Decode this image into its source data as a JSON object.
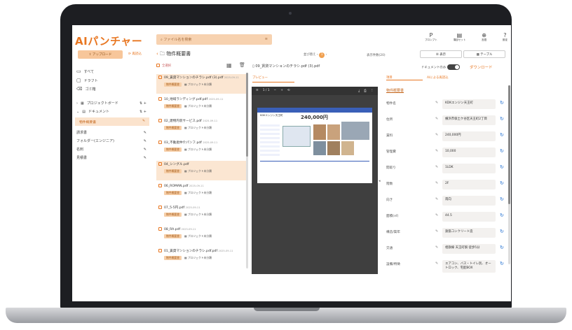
{
  "app": {
    "logo": "AIパンチャー"
  },
  "topbar": {
    "search_placeholder": "ファイル名を検索",
    "icons": [
      {
        "glyph": "P",
        "label": "プロンプト"
      },
      {
        "glyph": "▤",
        "label": "項目セット"
      },
      {
        "glyph": "⊕",
        "label": "言語"
      },
      {
        "glyph": "?",
        "label": "設定"
      }
    ]
  },
  "sidebar": {
    "upload_label": "アップロード",
    "reupload_label": "再読込",
    "items": [
      {
        "icon": "▭",
        "label": "すべて"
      },
      {
        "icon": "▢",
        "label": "ドラフト"
      },
      {
        "icon": "🗑",
        "label": "ゴミ箱"
      }
    ],
    "projects_label": "プロジェクトボード",
    "documents_label": "ドキュメント",
    "doc_items": [
      "物件概要書",
      "請求書",
      "フォルダー(エンジニア)",
      "名刺",
      "見積書"
    ]
  },
  "folder": {
    "title": "物件概要書",
    "select_all": "全選択",
    "sort_label": "並び替え",
    "pager": "1",
    "per_page": "表示件数(20)"
  },
  "files": [
    {
      "name": "09_賃貸マンションのチラシ.pdf (3).pdf",
      "date": "2025-09-11",
      "tag": "物件概要書",
      "proj": "プロジェクト未分類",
      "selected": true
    },
    {
      "name": "10_地域ランディング.pdf.pdf",
      "date": "2025-09-11",
      "tag": "物件概要書",
      "proj": "プロジェクト未分類",
      "selected": false
    },
    {
      "name": "02_建物内装サービス.pdf",
      "date": "2025-09-11",
      "tag": "物件概要書",
      "proj": "プロジェクト未分類",
      "selected": false
    },
    {
      "name": "03_不動産仲介パンフ.pdf",
      "date": "2025-09-11",
      "tag": "物件概要書",
      "proj": "プロジェクト未分類",
      "selected": false
    },
    {
      "name": "04_シングル.pdf",
      "date": "",
      "tag": "物件概要書",
      "proj": "プロジェクト未分類",
      "selected": true
    },
    {
      "name": "06_ROMAN.pdf",
      "date": "2025-09-11",
      "tag": "物件概要書",
      "proj": "プロジェクト未分類",
      "selected": false
    },
    {
      "name": "07_5-5円.pdf",
      "date": "2025-09-11",
      "tag": "物件概要書",
      "proj": "プロジェクト未分類",
      "selected": false
    },
    {
      "name": "08_RA.pdf",
      "date": "2025-09-11",
      "tag": "物件概要書",
      "proj": "プロジェクト未分類",
      "selected": false
    },
    {
      "name": "01_賃貸マンションのチラシ.pdf.pdf",
      "date": "2025-09-11",
      "tag": "物件概要書",
      "proj": "プロジェクト未分類",
      "selected": false
    }
  ],
  "viewer": {
    "file_title": "09_賃貸マンションのチラシ.pdf (3).pdf",
    "page": "1 / 1",
    "flyer_price": "240,000円",
    "flyer_title": "KDKエンジン天王町",
    "tab_preview": "プレビュー"
  },
  "right": {
    "toggle_label": "ドキュメントのみ",
    "download_label": "ダウンロード",
    "tab_all": "表示",
    "tab_table": "テーブル",
    "tab_fields": "項目",
    "tab_ai": "AIによる再読込",
    "section": "物件概要書",
    "fields": [
      {
        "label": "物件名",
        "value": "KDKエンジン天王町"
      },
      {
        "label": "住所",
        "value": "横浜市保土ケ谷区天王町2丁目"
      },
      {
        "label": "賃料",
        "value": "240,000円"
      },
      {
        "label": "管理費",
        "value": "10,000"
      },
      {
        "label": "間取り",
        "value": "1LDK"
      },
      {
        "label": "階数",
        "value": "2F"
      },
      {
        "label": "向き",
        "value": "南向"
      },
      {
        "label": "面積(㎡)",
        "value": "44.5"
      },
      {
        "label": "構造/築年",
        "value": "鉄筋コンクリート造"
      },
      {
        "label": "交通",
        "value": "相鉄線 天王町駅 徒歩5分"
      },
      {
        "label": "設備/特徴",
        "value": "エアコン、バス・トイレ別、オートロック、宅配BOX"
      }
    ]
  }
}
